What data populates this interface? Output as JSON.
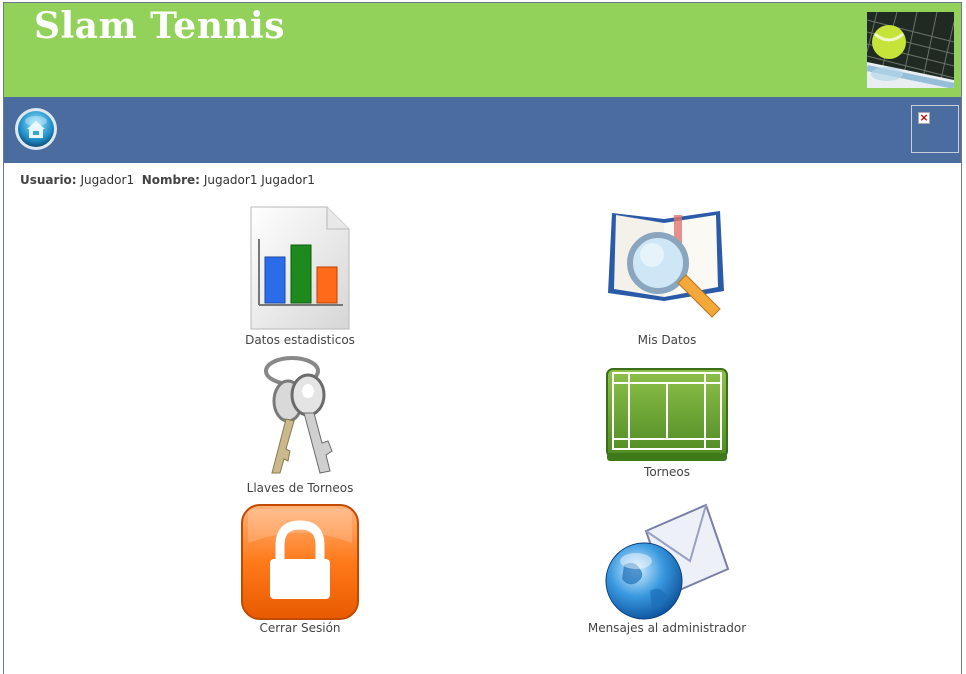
{
  "header": {
    "title": "Slam Tennis",
    "photo_icon": "tennis-ball-net-photo"
  },
  "navbar": {
    "home_icon": "home-icon",
    "broken_image_icon": "broken-image-icon"
  },
  "user": {
    "usuario_label": "Usuario:",
    "usuario_value": "Jugador1",
    "nombre_label": "Nombre:",
    "nombre_value": "Jugador1 Jugador1"
  },
  "menu": [
    {
      "label": "Datos estadisticos",
      "icon": "bar-chart-document-icon"
    },
    {
      "label": "Mis Datos",
      "icon": "book-magnifier-icon"
    },
    {
      "label": "Llaves de Torneos",
      "icon": "keys-icon"
    },
    {
      "label": "Torneos",
      "icon": "tennis-court-icon"
    },
    {
      "label": "Cerrar Sesión",
      "icon": "padlock-icon"
    },
    {
      "label": "Mensajes al administrador",
      "icon": "globe-mail-icon"
    }
  ],
  "colors": {
    "header_bg": "#92d25b",
    "navbar_bg": "#4a6c9e",
    "title_text": "#ffffff"
  }
}
